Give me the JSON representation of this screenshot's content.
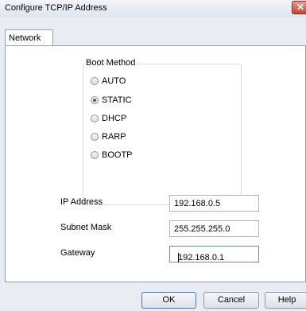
{
  "window": {
    "title": "Configure TCP/IP Address",
    "close_symbol": "✕"
  },
  "tabs": [
    {
      "label": "Network"
    }
  ],
  "boot_method": {
    "label": "Boot Method",
    "selected": "STATIC",
    "options": [
      {
        "label": "AUTO",
        "checked": false
      },
      {
        "label": "STATIC",
        "checked": true
      },
      {
        "label": "DHCP",
        "checked": false
      },
      {
        "label": "RARP",
        "checked": false
      },
      {
        "label": "BOOTP",
        "checked": false
      }
    ]
  },
  "fields": {
    "ip": {
      "label": "IP Address",
      "value": "192.168.0.5"
    },
    "subnet": {
      "label": "Subnet Mask",
      "value": "255.255.255.0"
    },
    "gateway": {
      "label": "Gateway",
      "value": "192.168.0.1"
    }
  },
  "buttons": {
    "ok": "OK",
    "cancel": "Cancel",
    "help": "Help"
  }
}
